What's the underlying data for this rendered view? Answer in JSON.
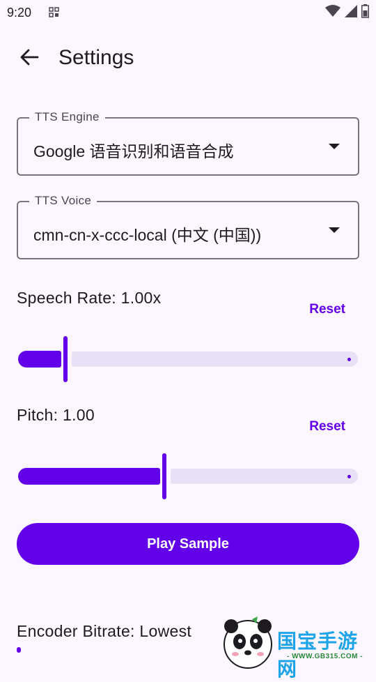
{
  "status_bar": {
    "time": "9:20"
  },
  "header": {
    "title": "Settings"
  },
  "tts_engine": {
    "label": "TTS Engine",
    "value": "Google 语音识别和语音合成"
  },
  "tts_voice": {
    "label": "TTS Voice",
    "value": "cmn-cn-x-ccc-local (中文 (中国))"
  },
  "speech_rate": {
    "label": "Speech Rate: 1.00x",
    "reset_label": "Reset",
    "fraction": 0.14
  },
  "pitch": {
    "label": "Pitch: 1.00",
    "reset_label": "Reset",
    "fraction": 0.43
  },
  "play_button": {
    "label": "Play Sample"
  },
  "encoder": {
    "label": "Encoder Bitrate: Lowest"
  },
  "watermark": {
    "brand": "国宝手游网",
    "site": "- WWW.GB315.COM -"
  },
  "colors": {
    "accent": "#6200ea",
    "background": "#fcf6fe",
    "track_inactive": "#e8e0f5"
  }
}
